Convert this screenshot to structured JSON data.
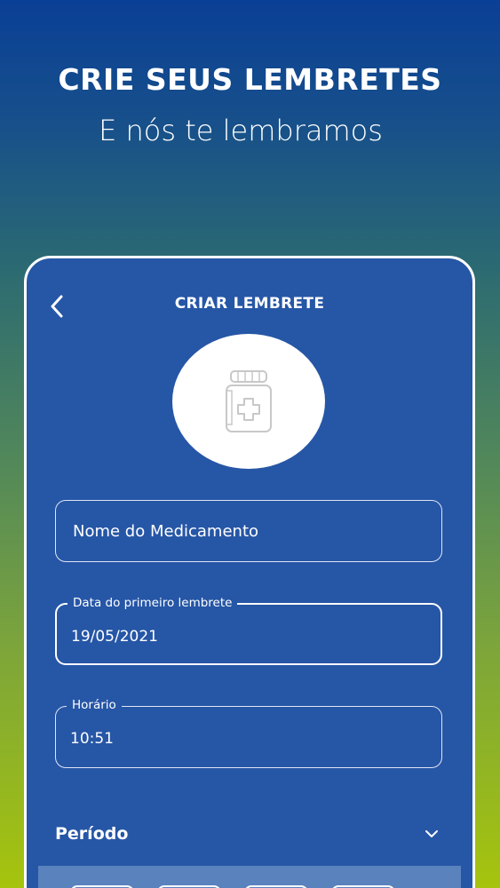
{
  "promo": {
    "headline": "CRIE SEUS LEMBRETES",
    "subline": "E nós te lembramos"
  },
  "screen": {
    "title": "CRIAR LEMBRETE",
    "back_icon": "chevron-left-icon",
    "medicine_icon": "medicine-bottle-icon"
  },
  "form": {
    "medication_name": {
      "placeholder": "Nome do Medicamento",
      "value": ""
    },
    "first_reminder_date": {
      "label": "Data do primeiro lembrete",
      "value": "19/05/2021"
    },
    "time": {
      "label": "Horário",
      "value": "10:51"
    }
  },
  "period": {
    "label": "Período",
    "expand_icon": "chevron-down-icon"
  },
  "colors": {
    "gradient_top": "#0a3f96",
    "gradient_bottom": "#a6c40d",
    "screen_background": "#2656a6",
    "panel_background": "#5a82bd"
  }
}
